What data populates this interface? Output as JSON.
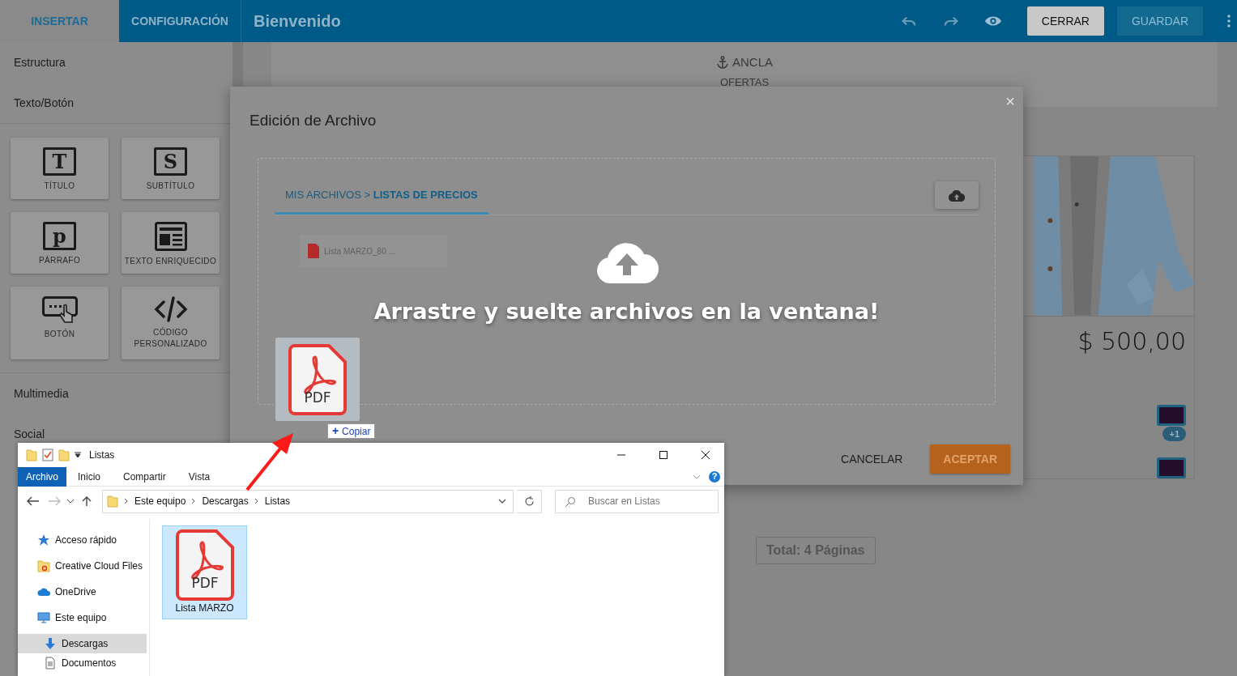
{
  "top_bar": {
    "tabs": [
      {
        "label": "INSERTAR",
        "selected": true
      },
      {
        "label": "CONFIGURACIÓN",
        "selected": false
      }
    ],
    "title": "Bienvenido",
    "buttons": [
      {
        "label": "CERRAR",
        "disabled": false
      },
      {
        "label": "GUARDAR",
        "disabled": true
      }
    ]
  },
  "sidebar": {
    "sections": [
      {
        "label": "Estructura"
      },
      {
        "label": "Texto/Botón",
        "tiles": [
          {
            "label": "TÍTULO",
            "kind": "letter",
            "glyph": "T"
          },
          {
            "label": "SUBTÍTULO",
            "kind": "letter",
            "glyph": "S"
          },
          {
            "label": "PÁRRAFO",
            "kind": "letter",
            "glyph": "p"
          },
          {
            "label": "TEXTO ENRIQUECIDO",
            "kind": "richtext"
          },
          {
            "label": "BOTÓN",
            "kind": "button"
          },
          {
            "label": "CÓDIGO PERSONALIZADO",
            "kind": "code"
          }
        ]
      },
      {
        "label": "Multimedia"
      },
      {
        "label": "Social"
      }
    ]
  },
  "canvas": {
    "anchor": {
      "label": "ANCLA",
      "name": "OFERTAS"
    },
    "product": {
      "price": "$ 500,00",
      "badge": "+1",
      "swatches": [
        {
          "color": "#230d2a"
        },
        {
          "color": "#230d2a"
        }
      ]
    },
    "pagination": "Total: 4 Páginas"
  },
  "modal": {
    "title": "Edición de Archivo",
    "close": "×",
    "breadcrumb": "MIS ARCHIVOS > **LISTAS DE PRECIOS**",
    "files": [
      {
        "name": "Lista MARZO_80 ..."
      }
    ],
    "drop_message": "Arrastre y suelte archivos en la ventana!",
    "buttons": [
      {
        "label": "CANCELAR",
        "kind": "text"
      },
      {
        "label": "ACEPTAR",
        "kind": "primary"
      }
    ]
  },
  "drag": {
    "file_type": "PDF",
    "tooltip": {
      "symbol": "+",
      "label": "Copiar"
    }
  },
  "explorer": {
    "title": "Listas",
    "ribbon_tabs": [
      {
        "label": "Archivo",
        "selected": true
      },
      {
        "label": "Inicio",
        "selected": false
      },
      {
        "label": "Compartir",
        "selected": false
      },
      {
        "label": "Vista",
        "selected": false
      }
    ],
    "help": "?",
    "path": [
      "Este equipo",
      "Descargas",
      "Listas"
    ],
    "search": {
      "placeholder": "Buscar en Listas"
    },
    "nav": [
      {
        "label": "Acceso rápido",
        "kind": "star",
        "selected": false
      },
      {
        "label": "Creative Cloud Files",
        "kind": "ccfolder",
        "selected": false
      },
      {
        "label": "OneDrive",
        "kind": "cloud",
        "selected": false
      },
      {
        "label": "Este equipo",
        "kind": "pc",
        "selected": false,
        "children": [
          {
            "label": "Descargas",
            "kind": "download",
            "selected": true
          },
          {
            "label": "Documentos",
            "kind": "doc",
            "selected": false
          }
        ]
      }
    ],
    "files": [
      {
        "name": "Lista MARZO",
        "file_type": "PDF",
        "selected": true
      }
    ]
  }
}
